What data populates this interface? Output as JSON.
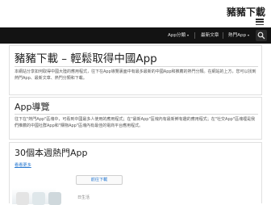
{
  "site": {
    "brand": "豬豬下載"
  },
  "nav": {
    "apps": "App分類",
    "new": "最新文章",
    "hot": "熱門App"
  },
  "intro": {
    "title": "豬豬下載 – 輕鬆取得中國App",
    "text": "本網站分享如何取得中國大陸的應用程式，往下在App導覽裏面中有最多最新的中國App和推薦的熱門分類。在網站的上方，您可以找到熱門App、最新文章、熱門分類和下載。"
  },
  "guide": {
    "title": "App導覽",
    "text": "往下在\"熱門App\"區塊中，可看到中國最多人使用的應用程式；在\"最新App\"區塊內有最新鮮有趣的應用程式；在\"社交App\"區塊裡是我們推薦的中國社群App和\"購物App\"區塊內有最佳的電商平台應用程式。"
  },
  "hot": {
    "title": "30個本週熱門App",
    "more_link": "看看更多",
    "download_button": "前往下載",
    "app_caption": "日生活"
  }
}
